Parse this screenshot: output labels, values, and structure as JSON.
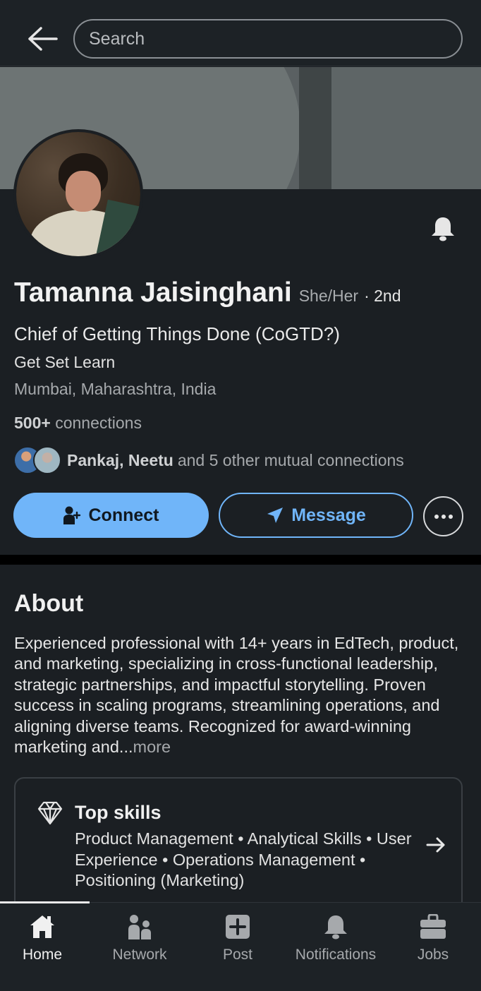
{
  "search": {
    "placeholder": "Search"
  },
  "profile": {
    "name": "Tamanna Jaisinghani",
    "pronouns": "She/Her",
    "degree": "· 2nd",
    "headline": "Chief of Getting Things Done (CoGTD?)",
    "company": "Get Set Learn",
    "location": "Mumbai, Maharashtra, India",
    "connections_count": "500+",
    "connections_label": "connections",
    "mutual_names": "Pankaj, Neetu",
    "mutual_rest": "and 5 other mutual connections"
  },
  "actions": {
    "connect_label": "Connect",
    "message_label": "Message"
  },
  "about": {
    "title": "About",
    "text": "Experienced professional with 14+ years in EdTech, product, and marketing, specializing in cross-functional leadership, strategic partnerships, and impactful storytelling. Proven success in scaling programs, streamlining operations, and aligning diverse teams. Recognized for award-winning marketing and...",
    "more_label": "more"
  },
  "top_skills": {
    "title": "Top skills",
    "list": "Product Management • Analytical Skills • User Experience • Operations Management • Positioning (Marketing)"
  },
  "nav": {
    "items": [
      {
        "label": "Home",
        "icon": "home-icon",
        "active": true
      },
      {
        "label": "Network",
        "icon": "network-icon",
        "active": false
      },
      {
        "label": "Post",
        "icon": "post-icon",
        "active": false
      },
      {
        "label": "Notifications",
        "icon": "notifications-icon",
        "active": false
      },
      {
        "label": "Jobs",
        "icon": "jobs-icon",
        "active": false
      }
    ]
  },
  "colors": {
    "accent": "#70b5f9",
    "background": "#1b1f23",
    "muted_text": "#a6a9ac"
  }
}
